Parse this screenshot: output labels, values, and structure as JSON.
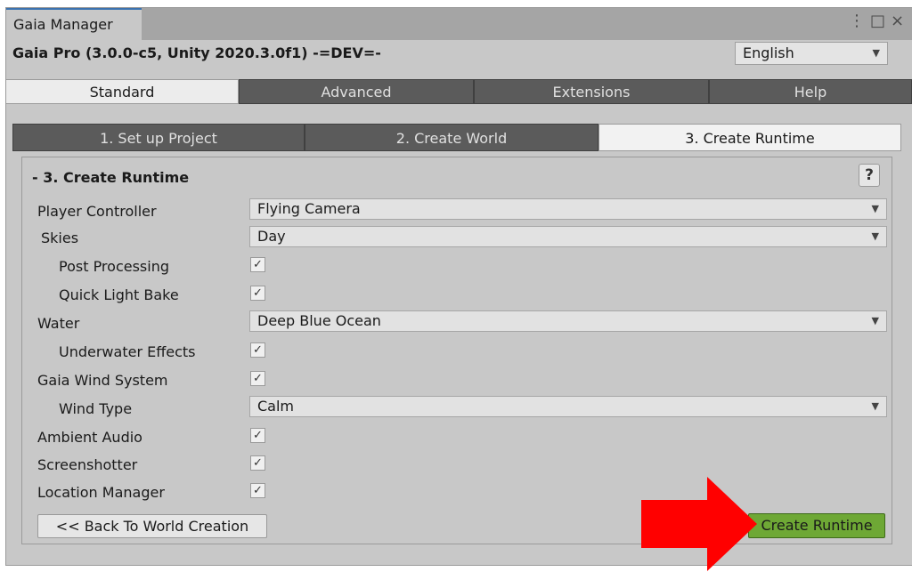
{
  "window": {
    "tab_title": "Gaia Manager",
    "icons": [
      "menu-dots-icon",
      "maximize-icon",
      "close-icon"
    ]
  },
  "header": {
    "title": "Gaia Pro (3.0.0-c5, Unity 2020.3.0f1) -=DEV=-",
    "language": "English"
  },
  "main_tabs": [
    "Standard",
    "Advanced",
    "Extensions",
    "Help"
  ],
  "main_tab_active": "Standard",
  "sub_tabs": [
    "1. Set up Project",
    "2. Create World",
    "3. Create Runtime"
  ],
  "sub_tab_active": "3. Create Runtime",
  "section": {
    "title": "- 3. Create Runtime",
    "help": "?"
  },
  "fields": {
    "player_controller": {
      "label": "Player Controller",
      "value": "Flying Camera"
    },
    "skies": {
      "label": "Skies",
      "value": "Day"
    },
    "post_processing": {
      "label": "Post Processing",
      "checked": true
    },
    "quick_light_bake": {
      "label": "Quick Light Bake",
      "checked": true
    },
    "water": {
      "label": "Water",
      "value": "Deep Blue Ocean"
    },
    "underwater_effects": {
      "label": "Underwater Effects",
      "checked": true
    },
    "gaia_wind_system": {
      "label": "Gaia Wind System",
      "checked": true
    },
    "wind_type": {
      "label": "Wind Type",
      "value": "Calm"
    },
    "ambient_audio": {
      "label": "Ambient Audio",
      "checked": true
    },
    "screenshotter": {
      "label": "Screenshotter",
      "checked": true
    },
    "location_manager": {
      "label": "Location Manager",
      "checked": true
    }
  },
  "buttons": {
    "back": "<< Back To World Creation",
    "create": "Create Runtime"
  },
  "colors": {
    "create_button": "#6ea835",
    "annotation_arrow": "#ff0000",
    "tab_inactive": "#5b5b5b",
    "tab_active": "#ececec"
  }
}
